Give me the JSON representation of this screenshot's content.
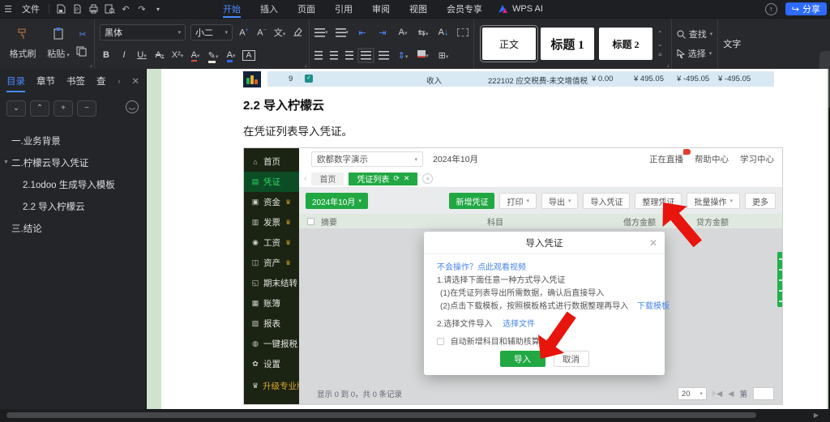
{
  "colors": {
    "wps_share_blue": "#2e6bff",
    "active_tab_blue": "#4a8cff",
    "app_green": "#21a843",
    "sidebar_active_green": "#35d463",
    "crown_gold": "#c9a02c",
    "arrow_red": "#e8150d",
    "workspace_green": "#cfe3cf"
  },
  "titlebar": {
    "file_menu": "文件",
    "tabs": [
      {
        "label": "开始"
      },
      {
        "label": "插入"
      },
      {
        "label": "页面"
      },
      {
        "label": "引用"
      },
      {
        "label": "审阅"
      },
      {
        "label": "视图"
      },
      {
        "label": "会员专享"
      }
    ],
    "wps_ai": "WPS AI",
    "share_label": "分享"
  },
  "ribbon": {
    "format_painter": "格式刷",
    "paste": "粘贴",
    "font_name": "黑体",
    "font_size": "小二",
    "styles": [
      {
        "label": "正文"
      },
      {
        "label": "标题 1"
      },
      {
        "label": "标题 2"
      }
    ],
    "find_label": "查找",
    "select_label": "选择",
    "text_tool": "文字"
  },
  "toc": {
    "tabs": [
      {
        "label": "目录"
      },
      {
        "label": "章节"
      },
      {
        "label": "书签"
      },
      {
        "label": "查找"
      }
    ],
    "items": [
      {
        "label": "一.业务背景"
      },
      {
        "label": "二.柠檬云导入凭证"
      },
      {
        "label": "2.1odoo 生成导入模板"
      },
      {
        "label": "2.2 导入柠檬云"
      },
      {
        "label": "三.结论"
      }
    ]
  },
  "document": {
    "row": {
      "num": "9",
      "type": "收入",
      "subject": "222102 应交税费-未交增值税",
      "v1": "¥ 0.00",
      "v2": "¥ 495.05",
      "v3": "¥ -495.05",
      "v4": "¥ -495.05"
    },
    "heading": "2.2 导入柠檬云",
    "paragraph": "在凭证列表导入凭证。"
  },
  "app": {
    "sidebar": [
      {
        "label": "首页"
      },
      {
        "label": "凭证"
      },
      {
        "label": "资金"
      },
      {
        "label": "发票"
      },
      {
        "label": "工资"
      },
      {
        "label": "资产"
      },
      {
        "label": "期末结转"
      },
      {
        "label": "账簿"
      },
      {
        "label": "报表"
      },
      {
        "label": "一键报税"
      },
      {
        "label": "设置"
      },
      {
        "label": "升级专业版"
      }
    ],
    "header": {
      "company": "欧都数字演示",
      "period": "2024年10月",
      "live": "正在直播",
      "help": "帮助中心",
      "learn": "学习中心"
    },
    "tabs": {
      "home": "首页",
      "current": "凭证列表"
    },
    "toolbar": {
      "period": "2024年10月",
      "new": "新增凭证",
      "print": "打印",
      "export": "导出",
      "import": "导入凭证",
      "organize": "整理凭证",
      "batch": "批量操作",
      "more": "更多"
    },
    "table": {
      "headers": [
        "摘要",
        "科目",
        "借方金额",
        "贷方金额"
      ]
    },
    "modal": {
      "title": "导入凭证",
      "video_link": "不会操作？点此观看视频",
      "step1": "1.请选择下面任意一种方式导入凭证",
      "step1a": "(1)在凭证列表导出所需数据，确认后直接导入",
      "step1b": "(2)点击下载模板，按照模板格式进行数据整理再导入",
      "download_link": "下载模板",
      "step2": "2.选择文件导入",
      "choose_file": "选择文件",
      "checkbox_label": "自动新增科目和辅助核算",
      "import_btn": "导入",
      "cancel_btn": "取消"
    },
    "footer": {
      "summary": "显示 0 到 0，共 0 条记录",
      "page_size": "20",
      "page_prefix": "第"
    }
  }
}
